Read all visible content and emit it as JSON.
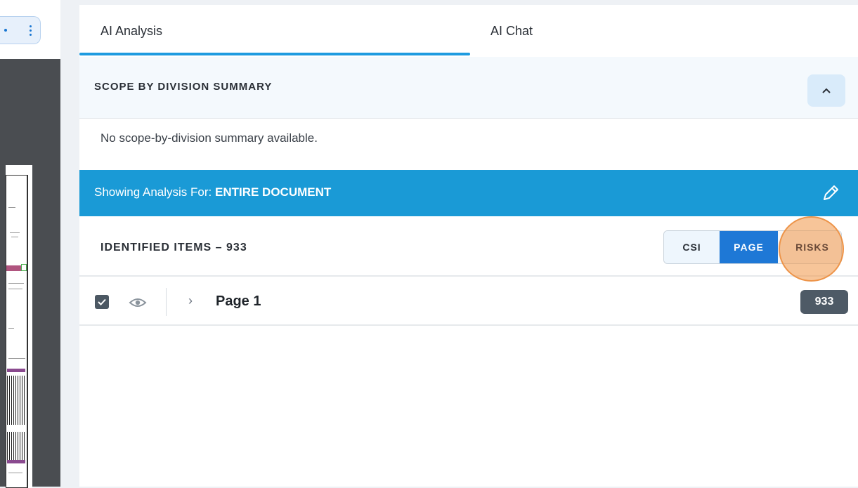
{
  "tabs": [
    {
      "label": "AI Analysis",
      "active": true
    },
    {
      "label": "AI Chat",
      "active": false
    }
  ],
  "scope_section": {
    "title": "SCOPE BY DIVISION SUMMARY",
    "collapse_icon": "chevron-up-icon",
    "empty_message": "No scope-by-division summary available."
  },
  "analysis_bar": {
    "prefix": "Showing Analysis For:",
    "target": "ENTIRE DOCUMENT",
    "edit_icon": "pencil-icon",
    "color": "#1a9ad6"
  },
  "identified_items": {
    "title": "IDENTIFIED ITEMS – 933",
    "view_toggle": {
      "options": [
        "CSI",
        "PAGE",
        "RISKS"
      ],
      "selected": "PAGE"
    }
  },
  "page_groups": [
    {
      "label": "Page 1",
      "count": "933",
      "checked": true
    }
  ],
  "colors": {
    "accent": "#1e9be0",
    "selected_toggle": "#1e78d6",
    "badge": "#4e5a66"
  }
}
